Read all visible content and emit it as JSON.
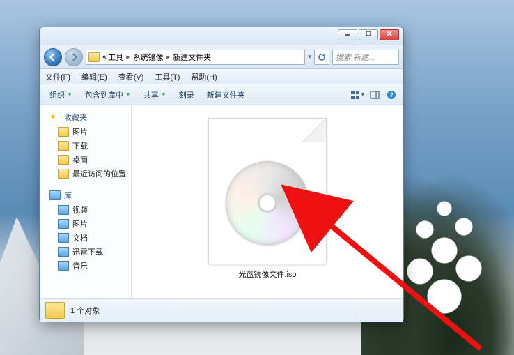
{
  "breadcrumb": {
    "lead": "«",
    "p1": "工具",
    "p2": "系统镜像",
    "p3": "新建文件夹"
  },
  "search": {
    "placeholder": "搜索 新建..."
  },
  "menu": {
    "file": "文件(F)",
    "edit": "编辑(E)",
    "view": "查看(V)",
    "tools": "工具(T)",
    "help": "帮助(H)"
  },
  "toolbar": {
    "organize": "组织",
    "include": "包含到库中",
    "share": "共享",
    "burn": "刻录",
    "newfolder": "新建文件夹"
  },
  "sidebar": {
    "fav": "收藏夹",
    "fav_items": [
      "图片",
      "下载",
      "桌面",
      "最近访问的位置"
    ],
    "lib": "库",
    "lib_items": [
      "视频",
      "图片",
      "文档",
      "迅雷下载",
      "音乐"
    ]
  },
  "file": {
    "name": "光盘镜像文件.iso"
  },
  "status": {
    "count": "1 个对象"
  }
}
